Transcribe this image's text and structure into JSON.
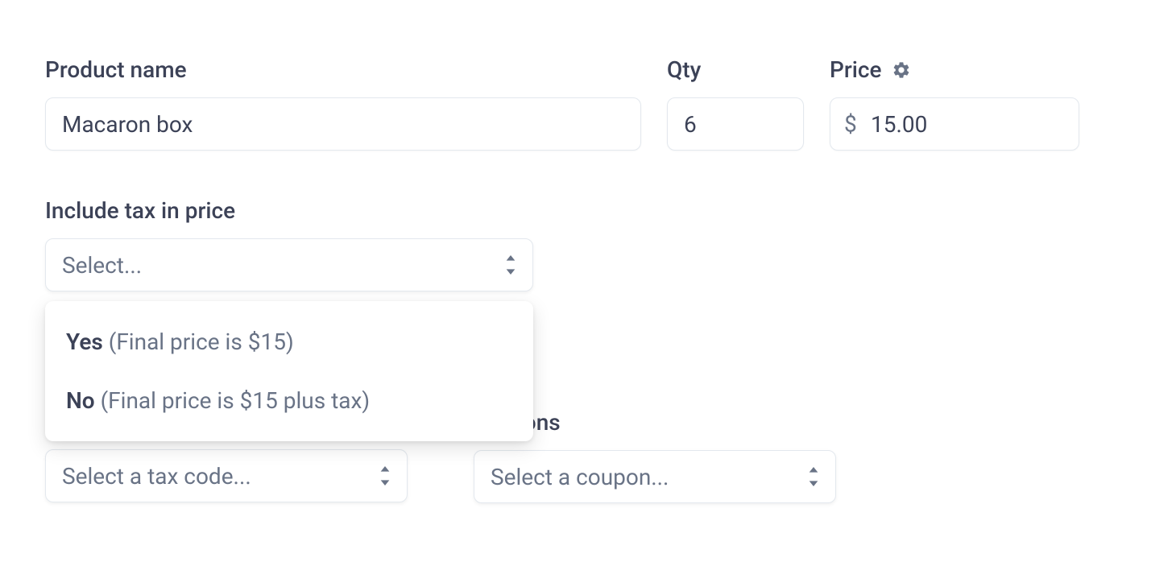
{
  "labels": {
    "product_name": "Product name",
    "qty": "Qty",
    "price": "Price",
    "include_tax": "Include tax in price",
    "coupons": "coupons"
  },
  "values": {
    "product_name": "Macaron box",
    "qty": "6",
    "price": "15.00",
    "currency_symbol": "$"
  },
  "placeholders": {
    "include_tax_select": "Select...",
    "tax_code_select": "Select a tax code...",
    "coupon_select": "Select a coupon..."
  },
  "dropdown": {
    "options": [
      {
        "bold": "Yes",
        "rest": " (Final price is $15)"
      },
      {
        "bold": "No",
        "rest": " (Final price is $15 plus tax)"
      }
    ]
  }
}
